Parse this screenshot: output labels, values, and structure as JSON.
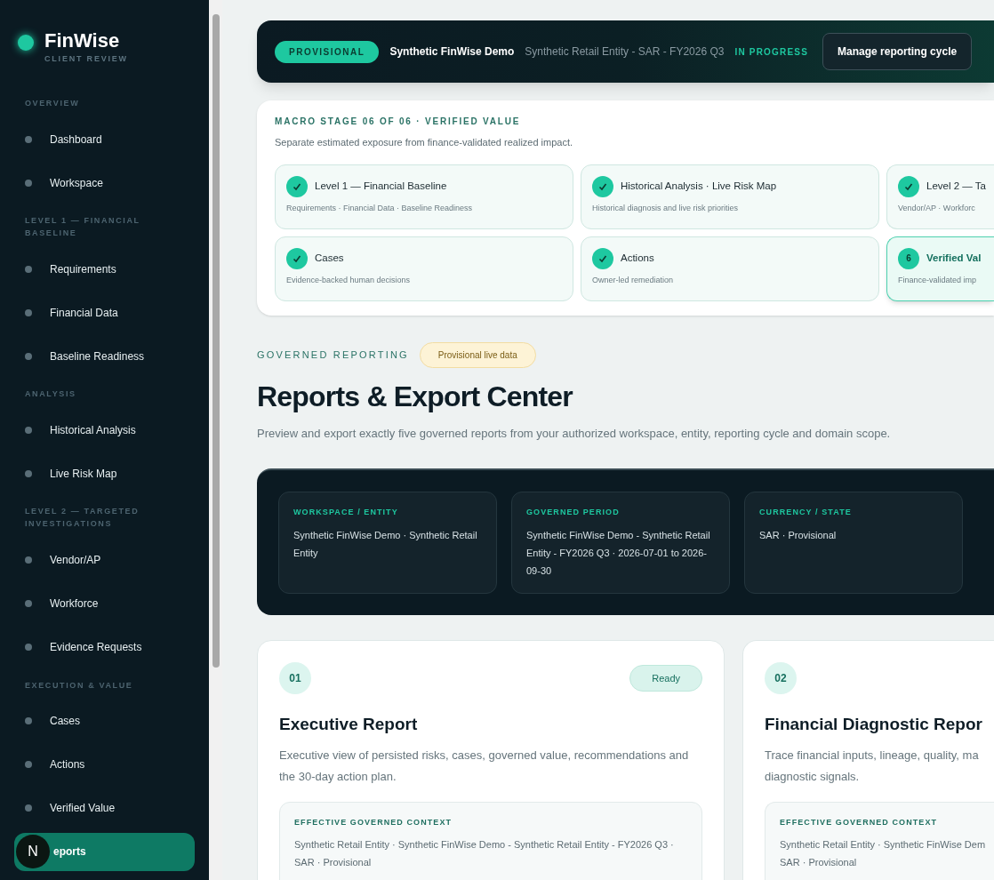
{
  "brand": {
    "name": "FinWise",
    "subtitle": "CLIENT REVIEW"
  },
  "sidebar": {
    "sections": [
      {
        "heading": "OVERVIEW",
        "items": [
          {
            "label": "Dashboard",
            "selected": false
          },
          {
            "label": "Workspace",
            "selected": false
          }
        ]
      },
      {
        "heading": "LEVEL 1 — FINANCIAL BASELINE",
        "items": [
          {
            "label": "Requirements",
            "selected": false
          },
          {
            "label": "Financial Data",
            "selected": false
          },
          {
            "label": "Baseline Readiness",
            "selected": false
          }
        ]
      },
      {
        "heading": "ANALYSIS",
        "items": [
          {
            "label": "Historical Analysis",
            "selected": false
          },
          {
            "label": "Live Risk Map",
            "selected": false
          }
        ]
      },
      {
        "heading": "LEVEL 2 — TARGETED INVESTIGATIONS",
        "items": [
          {
            "label": "Vendor/AP",
            "selected": false
          },
          {
            "label": "Workforce",
            "selected": false
          },
          {
            "label": "Evidence Requests",
            "selected": false
          }
        ]
      },
      {
        "heading": "EXECUTION & VALUE",
        "items": [
          {
            "label": "Cases",
            "selected": false
          },
          {
            "label": "Actions",
            "selected": false
          },
          {
            "label": "Verified Value",
            "selected": false
          },
          {
            "label": "eports",
            "selected": true
          }
        ]
      }
    ]
  },
  "dev_badge": "N",
  "top_bar": {
    "badge": "PROVISIONAL",
    "workspace": "Synthetic FinWise Demo",
    "context": "Synthetic Retail Entity - SAR - FY2026 Q3",
    "status": "IN PROGRESS",
    "button": "Manage reporting cycle"
  },
  "stage_panel": {
    "eyebrow": "MACRO STAGE 06 OF 06 · VERIFIED VALUE",
    "description": "Separate estimated exposure from finance-validated realized impact.",
    "stages": [
      {
        "title": "Level 1 — Financial Baseline",
        "detail": "Requirements · Financial Data · Baseline Readiness",
        "done": true
      },
      {
        "title": "Historical Analysis · Live Risk Map",
        "detail": "Historical diagnosis and live risk priorities",
        "done": true
      },
      {
        "title": "Level 2 — Ta",
        "detail": "Vendor/AP · Workforc",
        "done": true
      },
      {
        "title": "Cases",
        "detail": "Evidence-backed human decisions",
        "done": true
      },
      {
        "title": "Actions",
        "detail": "Owner-led remediation",
        "done": true
      },
      {
        "title": "Verified Val",
        "detail": "Finance-validated imp",
        "done": false,
        "number": "6"
      }
    ]
  },
  "header": {
    "eyebrow": "GOVERNED REPORTING",
    "badge": "Provisional live data",
    "title": "Reports & Export Center",
    "description": "Preview and export exactly five governed reports from your authorized workspace, entity, reporting cycle and domain scope."
  },
  "context_cards": [
    {
      "label": "WORKSPACE / ENTITY",
      "value": "Synthetic FinWise Demo · Synthetic Retail Entity"
    },
    {
      "label": "GOVERNED PERIOD",
      "value": "Synthetic FinWise Demo - Synthetic Retail Entity - FY2026 Q3 · 2026-07-01 to 2026-09-30"
    },
    {
      "label": "CURRENCY / STATE",
      "value": "SAR · Provisional"
    }
  ],
  "reports": [
    {
      "number": "01",
      "status": "Ready",
      "title": "Executive Report",
      "description": "Executive view of persisted risks, cases, governed value, recommendations and the 30-day action plan.",
      "context_label": "EFFECTIVE GOVERNED CONTEXT",
      "context": "Synthetic Retail Entity · Synthetic FinWise Demo - Synthetic Retail Entity - FY2026 Q3 · SAR · Provisional"
    },
    {
      "number": "02",
      "title": "Financial Diagnostic Repor",
      "description": "Trace financial inputs, lineage, quality, ma diagnostic signals.",
      "context_label": "EFFECTIVE GOVERNED CONTEXT",
      "context": "Synthetic Retail Entity · Synthetic FinWise Dem SAR · Provisional"
    }
  ]
}
